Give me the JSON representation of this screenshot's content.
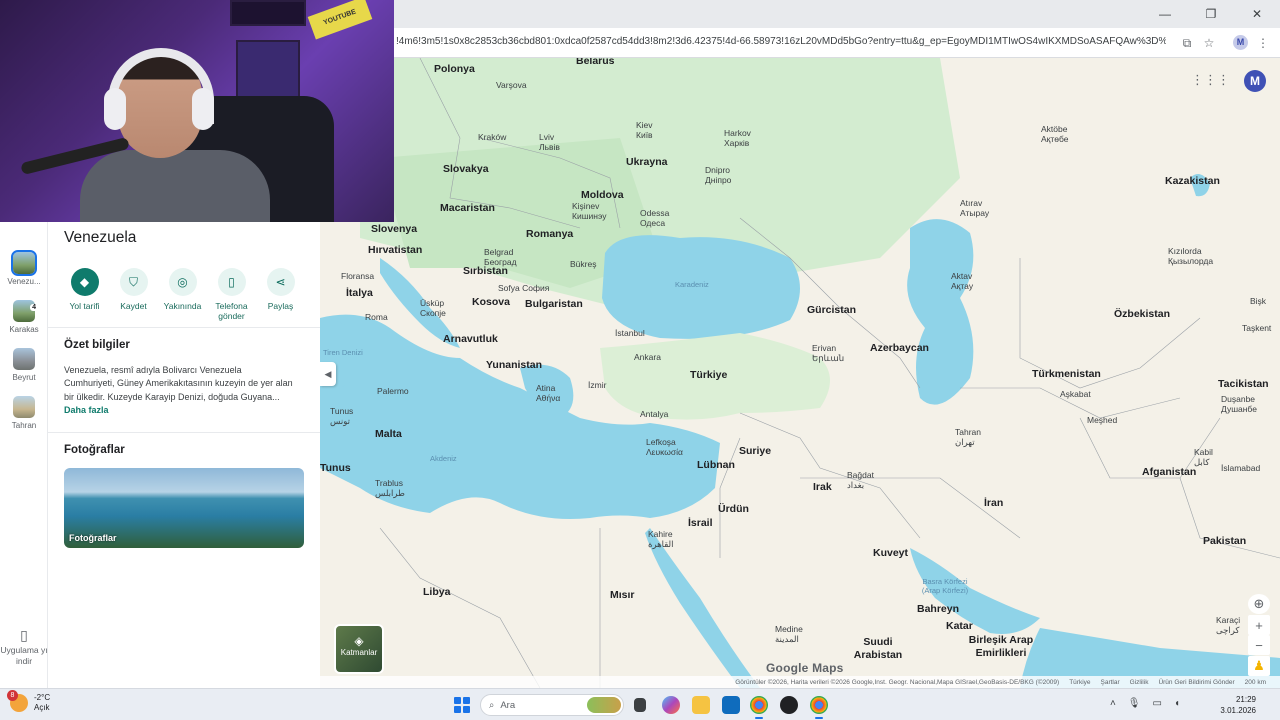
{
  "browser": {
    "url": "!4m6!3m5!1s0x8c2853cb36cbd801:0xdca0f2587cd54dd3!8m2!3d6.42375!4d-66.58973!16zL20vMDd5bGo?entry=ttu&g_ep=EgoyMDI1MTIwOS4wIKXMDSoASAFQAw%3D%3D",
    "profile_initial": "M",
    "window_controls": [
      "—",
      "❐",
      "✕"
    ]
  },
  "rail": {
    "items": [
      {
        "label": "Venezu...",
        "active": true
      },
      {
        "label": "Karakas",
        "badge": "4"
      },
      {
        "label": "Beyrut"
      },
      {
        "label": "Tahran"
      }
    ],
    "download_label": "Uygulama yı indir"
  },
  "panel": {
    "title": "Venezuela",
    "actions": [
      {
        "label": "Yol tarifi",
        "icon": "directions-icon",
        "glyph": "◆"
      },
      {
        "label": "Kaydet",
        "icon": "bookmark-icon",
        "glyph": "⛉"
      },
      {
        "label": "Yakınında",
        "icon": "nearby-icon",
        "glyph": "◎"
      },
      {
        "label": "Telefona gönder",
        "icon": "phone-icon",
        "glyph": "▯"
      },
      {
        "label": "Paylaş",
        "icon": "share-icon",
        "glyph": "⋖"
      }
    ],
    "summary_title": "Özet bilgiler",
    "summary_text": "Venezuela, resmî adıyla Bolivarcı Venezuela Cumhuriyeti, Güney Amerikakıtasının kuzeyin de yer alan bir ülkedir. Kuzeyde Karayip Denizi, doğuda Guyana...",
    "more_link": "Daha fazla",
    "photos_title": "Fotoğraflar",
    "photo_label": "Fotoğraflar"
  },
  "map": {
    "user_initial": "M",
    "layers_label": "Katmanlar",
    "logo": "Google Maps",
    "attribution": [
      "Görüntüler ©2026, Harita verileri ©2026 Google,Inst. Geogr. Nacional,Mapa GISrael,GeoBasis-DE/BKG (©2009)",
      "Türkiye",
      "Şartlar",
      "Gizlilik",
      "Ürün Geri Bildirimi Gönder",
      "200 km"
    ],
    "countries": [
      {
        "name": "Polonya"
      },
      {
        "name": "Belarus"
      },
      {
        "name": "Ukrayna"
      },
      {
        "name": "Slovakya"
      },
      {
        "name": "Moldova"
      },
      {
        "name": "Macaristan"
      },
      {
        "name": "Romanya"
      },
      {
        "name": "Slovenya"
      },
      {
        "name": "Hırvatistan"
      },
      {
        "name": "Sırbistan"
      },
      {
        "name": "Bulgaristan"
      },
      {
        "name": "Kosova"
      },
      {
        "name": "İtalya"
      },
      {
        "name": "Arnavutluk"
      },
      {
        "name": "Yunanistan"
      },
      {
        "name": "Türkiye"
      },
      {
        "name": "Gürcistan"
      },
      {
        "name": "Azerbaycan"
      },
      {
        "name": "Kazakistan"
      },
      {
        "name": "Özbekistan"
      },
      {
        "name": "Türkmenistan"
      },
      {
        "name": "Tacikistan"
      },
      {
        "name": "Malta"
      },
      {
        "name": "Suriye"
      },
      {
        "name": "Lübnan"
      },
      {
        "name": "Irak"
      },
      {
        "name": "İran"
      },
      {
        "name": "Afganistan"
      },
      {
        "name": "İsrail"
      },
      {
        "name": "Ürdün"
      },
      {
        "name": "Kuveyt"
      },
      {
        "name": "Pakistan"
      },
      {
        "name": "Libya"
      },
      {
        "name": "Mısır"
      },
      {
        "name": "Bahreyn"
      },
      {
        "name": "Katar"
      },
      {
        "name": "Suudi Arabistan"
      },
      {
        "name": "Birleşik Arap Emirlikleri"
      },
      {
        "name": "Tunus"
      }
    ],
    "cities": [
      {
        "name": "Varşova"
      },
      {
        "name": "Kraków"
      },
      {
        "name": "Lviv Львів"
      },
      {
        "name": "Kiev Київ"
      },
      {
        "name": "Harkov Харків"
      },
      {
        "name": "Dnipro Дніпро"
      },
      {
        "name": "Kişinev Кишинэу"
      },
      {
        "name": "Odessa Одеса"
      },
      {
        "name": "Belgrad Београд"
      },
      {
        "name": "Bükreş"
      },
      {
        "name": "Sofya София"
      },
      {
        "name": "Üsküp Скопје"
      },
      {
        "name": "Floransa"
      },
      {
        "name": "Roma"
      },
      {
        "name": "İstanbul"
      },
      {
        "name": "Ankara"
      },
      {
        "name": "İzmir"
      },
      {
        "name": "Atina Αθήνα"
      },
      {
        "name": "Antalya"
      },
      {
        "name": "Palermo"
      },
      {
        "name": "Tunus تونس"
      },
      {
        "name": "Trablus طرابلس"
      },
      {
        "name": "Lefkoşa Λευκωσία"
      },
      {
        "name": "Kahire القاهرة"
      },
      {
        "name": "Bağdat بغداد"
      },
      {
        "name": "Erivan Երևան"
      },
      {
        "name": "Tahran تهران"
      },
      {
        "name": "Meşhed"
      },
      {
        "name": "Aşkabat"
      },
      {
        "name": "Duşanbe Душанбе"
      },
      {
        "name": "Kabil کابل"
      },
      {
        "name": "İslamabad"
      },
      {
        "name": "Karaçi کراچی"
      },
      {
        "name": "Medine المدينة"
      },
      {
        "name": "Aktöbe Ақтөбе"
      },
      {
        "name": "Atırav Атырау"
      },
      {
        "name": "Aktav Ақтау"
      },
      {
        "name": "Kızılorda Қызылорда"
      },
      {
        "name": "Taşkent"
      },
      {
        "name": "Bişk"
      }
    ],
    "waters": [
      {
        "name": "Karadeniz"
      },
      {
        "name": "Akdeniz"
      },
      {
        "name": "Tiren Denizi"
      },
      {
        "name": "Basra Körfezi (Arap Körfezi)"
      }
    ]
  },
  "taskbar": {
    "notif_count": "8",
    "weather_temp": "-2°C",
    "weather_desc": "Açık",
    "search_placeholder": "Ara",
    "time": "21:29",
    "date": "3.01.2026"
  },
  "webcam": {
    "sign_text": "YOUTUBE"
  }
}
